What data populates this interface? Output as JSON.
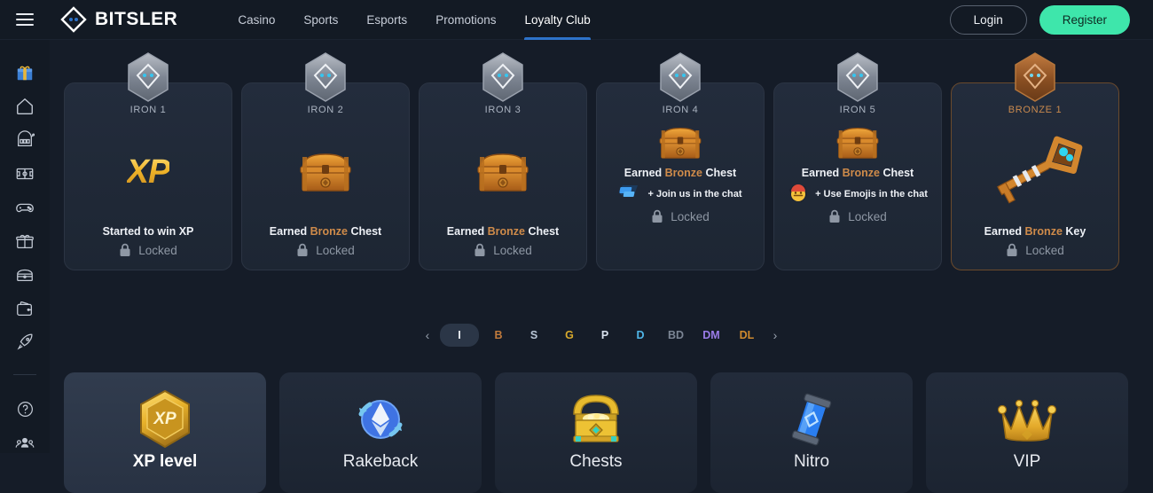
{
  "header": {
    "menu_icon": "hamburger-icon",
    "brand": "BITSLER",
    "nav": [
      {
        "label": "Casino",
        "active": false
      },
      {
        "label": "Sports",
        "active": false
      },
      {
        "label": "Esports",
        "active": false
      },
      {
        "label": "Promotions",
        "active": false
      },
      {
        "label": "Loyalty Club",
        "active": true
      }
    ],
    "login_label": "Login",
    "register_label": "Register",
    "accent_register": "#3ee6ab",
    "accent_active_tab": "#2d72c9"
  },
  "sidebar": {
    "items": [
      {
        "icon": "gift-promo-icon"
      },
      {
        "icon": "home-icon"
      },
      {
        "icon": "casino-slots-icon"
      },
      {
        "icon": "sports-field-icon"
      },
      {
        "icon": "esports-gamepad-icon"
      },
      {
        "icon": "gift-box-icon"
      },
      {
        "icon": "chest-store-icon"
      },
      {
        "icon": "wallet-icon"
      },
      {
        "icon": "rocket-icon"
      }
    ],
    "footer_items": [
      {
        "icon": "help-circle-icon"
      },
      {
        "icon": "affiliates-users-icon"
      }
    ]
  },
  "tiers": [
    {
      "name": "IRON 1",
      "badge": "iron-hex-badge",
      "art": "xp-text",
      "desc_prefix": "Started to win XP",
      "desc_highlight": "",
      "desc_suffix": "",
      "task": null,
      "status": "Locked",
      "style": "iron"
    },
    {
      "name": "IRON 2",
      "badge": "iron-hex-badge",
      "art": "bronze-chest",
      "desc_prefix": "Earned ",
      "desc_highlight": "Bronze",
      "desc_suffix": " Chest",
      "task": null,
      "status": "Locked",
      "style": "iron"
    },
    {
      "name": "IRON 3",
      "badge": "iron-hex-badge",
      "art": "bronze-chest",
      "desc_prefix": "Earned ",
      "desc_highlight": "Bronze",
      "desc_suffix": " Chest",
      "task": null,
      "status": "Locked",
      "style": "iron"
    },
    {
      "name": "IRON 4",
      "badge": "iron-hex-badge",
      "art": "bronze-chest",
      "desc_prefix": "Earned ",
      "desc_highlight": "Bronze",
      "desc_suffix": " Chest",
      "task": {
        "icon": "chat-bubbles-icon",
        "label": "+ Join us in the chat"
      },
      "status": "Locked",
      "style": "iron"
    },
    {
      "name": "IRON 5",
      "badge": "iron-hex-badge",
      "art": "bronze-chest",
      "desc_prefix": "Earned ",
      "desc_highlight": "Bronze",
      "desc_suffix": " Chest",
      "task": {
        "icon": "emoji-face-icon",
        "label": "+ Use Emojis in the chat"
      },
      "status": "Locked",
      "style": "iron"
    },
    {
      "name": "BRONZE 1",
      "badge": "bronze-hex-badge",
      "art": "bronze-key",
      "desc_prefix": "Earned ",
      "desc_highlight": "Bronze",
      "desc_suffix": " Key",
      "task": null,
      "status": "Locked",
      "style": "bronze"
    }
  ],
  "pagination": {
    "prev": "‹",
    "next": "›",
    "items": [
      {
        "label": "I",
        "color": "#eef1f6",
        "active": true
      },
      {
        "label": "B",
        "color": "#c07a3c",
        "active": false
      },
      {
        "label": "S",
        "color": "#b9c6d6",
        "active": false
      },
      {
        "label": "G",
        "color": "#d8a92c",
        "active": false
      },
      {
        "label": "P",
        "color": "#d7e0ec",
        "active": false
      },
      {
        "label": "D",
        "color": "#4fb6e8",
        "active": false
      },
      {
        "label": "BD",
        "color": "#7b8594",
        "active": false
      },
      {
        "label": "DM",
        "color": "#9a7ce8",
        "active": false
      },
      {
        "label": "DL",
        "color": "#d08a2e",
        "active": false
      }
    ]
  },
  "features": [
    {
      "label": "XP level",
      "icon": "xp-hex-badge-icon",
      "active": true
    },
    {
      "label": "Rakeback",
      "icon": "rakeback-eth-icon",
      "active": false
    },
    {
      "label": "Chests",
      "icon": "open-gold-chest-icon",
      "active": false
    },
    {
      "label": "Nitro",
      "icon": "nitro-vial-icon",
      "active": false
    },
    {
      "label": "VIP",
      "icon": "gold-crown-icon",
      "active": false
    }
  ]
}
